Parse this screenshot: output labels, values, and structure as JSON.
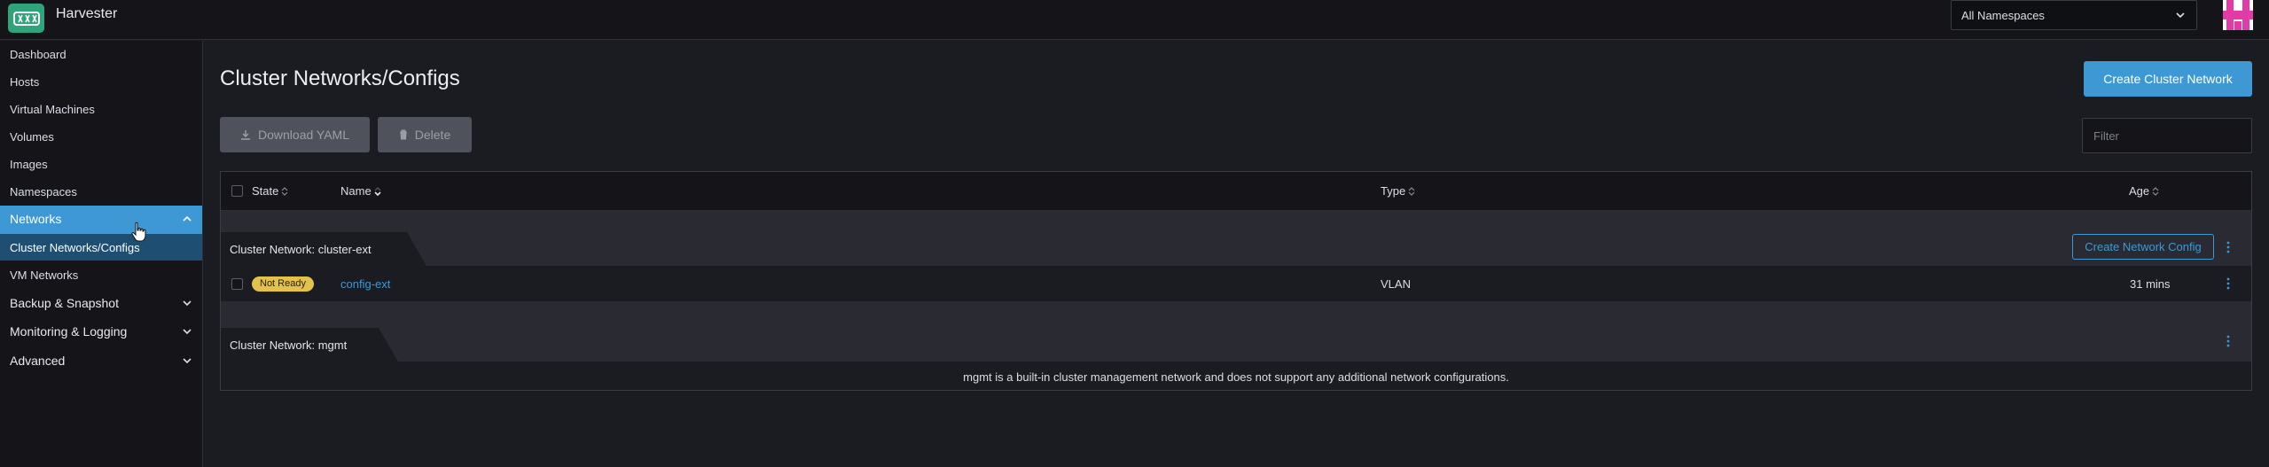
{
  "app": {
    "title": "Harvester"
  },
  "header": {
    "namespace_select": "All Namespaces"
  },
  "sidebar": {
    "items": [
      {
        "label": "Dashboard"
      },
      {
        "label": "Hosts"
      },
      {
        "label": "Virtual Machines"
      },
      {
        "label": "Volumes"
      },
      {
        "label": "Images"
      },
      {
        "label": "Namespaces"
      }
    ],
    "networks": {
      "label": "Networks",
      "children": [
        {
          "label": "Cluster Networks/Configs"
        },
        {
          "label": "VM Networks"
        }
      ]
    },
    "groups": [
      {
        "label": "Backup & Snapshot"
      },
      {
        "label": "Monitoring & Logging"
      },
      {
        "label": "Advanced"
      }
    ]
  },
  "main": {
    "title": "Cluster Networks/Configs",
    "create_button": "Create Cluster Network",
    "download_button": "Download YAML",
    "delete_button": "Delete",
    "filter_placeholder": "Filter",
    "columns": {
      "state": "State",
      "name": "Name",
      "type": "Type",
      "age": "Age"
    },
    "groups": [
      {
        "label": "Cluster Network: cluster-ext",
        "action": "Create Network Config",
        "rows": [
          {
            "state": "Not Ready",
            "name": "config-ext",
            "type": "VLAN",
            "age": "31 mins"
          }
        ]
      },
      {
        "label": "Cluster Network: mgmt",
        "note": "mgmt is a built-in cluster management network and does not support any additional network configurations."
      }
    ]
  },
  "colors": {
    "accent": "#3d98d3",
    "logo": "#2fa37a",
    "badge_warning": "#e3c24b",
    "background": "#1b1c21"
  }
}
